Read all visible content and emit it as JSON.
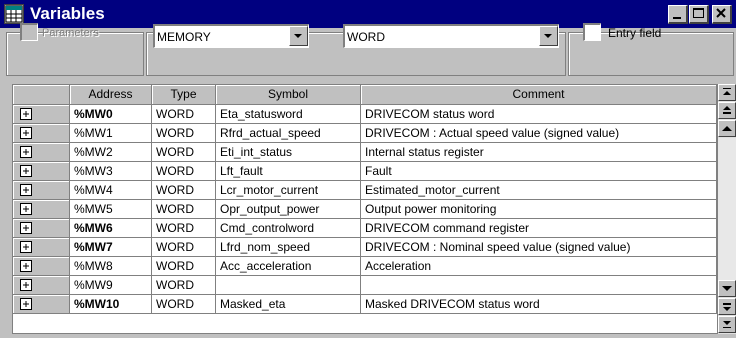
{
  "window": {
    "title": "Variables"
  },
  "toolbar": {
    "parameters_label": "Parameters",
    "parameters_checked": false,
    "parameters_enabled": false,
    "memory_combo_value": "MEMORY",
    "type_combo_value": "WORD",
    "entry_field_label": "Entry field",
    "entry_field_checked": false
  },
  "table": {
    "headers": {
      "address": "Address",
      "type": "Type",
      "symbol": "Symbol",
      "comment": "Comment"
    },
    "rows": [
      {
        "address": "%MW0",
        "bold": true,
        "type": "WORD",
        "symbol": "Eta_statusword",
        "comment": "DRIVECOM status word"
      },
      {
        "address": "%MW1",
        "bold": false,
        "type": "WORD",
        "symbol": "Rfrd_actual_speed",
        "comment": "DRIVECOM : Actual speed value (signed value)"
      },
      {
        "address": "%MW2",
        "bold": false,
        "type": "WORD",
        "symbol": "Eti_int_status",
        "comment": "Internal status register"
      },
      {
        "address": "%MW3",
        "bold": false,
        "type": "WORD",
        "symbol": "Lft_fault",
        "comment": "Fault"
      },
      {
        "address": "%MW4",
        "bold": false,
        "type": "WORD",
        "symbol": "Lcr_motor_current",
        "comment": "Estimated_motor_current"
      },
      {
        "address": "%MW5",
        "bold": false,
        "type": "WORD",
        "symbol": "Opr_output_power",
        "comment": "Output power monitoring"
      },
      {
        "address": "%MW6",
        "bold": true,
        "type": "WORD",
        "symbol": "Cmd_controlword",
        "comment": "DRIVECOM command register"
      },
      {
        "address": "%MW7",
        "bold": true,
        "type": "WORD",
        "symbol": "Lfrd_nom_speed",
        "comment": "DRIVECOM : Nominal speed value (signed value)"
      },
      {
        "address": "%MW8",
        "bold": false,
        "type": "WORD",
        "symbol": "Acc_acceleration",
        "comment": "Acceleration"
      },
      {
        "address": "%MW9",
        "bold": false,
        "type": "WORD",
        "symbol": "",
        "comment": ""
      },
      {
        "address": "%MW10",
        "bold": true,
        "type": "WORD",
        "symbol": "Masked_eta",
        "comment": "Masked DRIVECOM status word"
      }
    ]
  },
  "icons": {
    "app": "variables-window-icon",
    "expand": "plus-box-icon",
    "minimize": "minimize-icon",
    "maximize": "maximize-icon",
    "close": "close-icon",
    "scroll": [
      "scroll-top-icon",
      "page-up-icon",
      "line-up-icon",
      "line-down-icon",
      "page-down-icon",
      "scroll-bottom-icon"
    ]
  },
  "colors": {
    "title_bar": "#000080",
    "face": "#c0c0c0"
  }
}
